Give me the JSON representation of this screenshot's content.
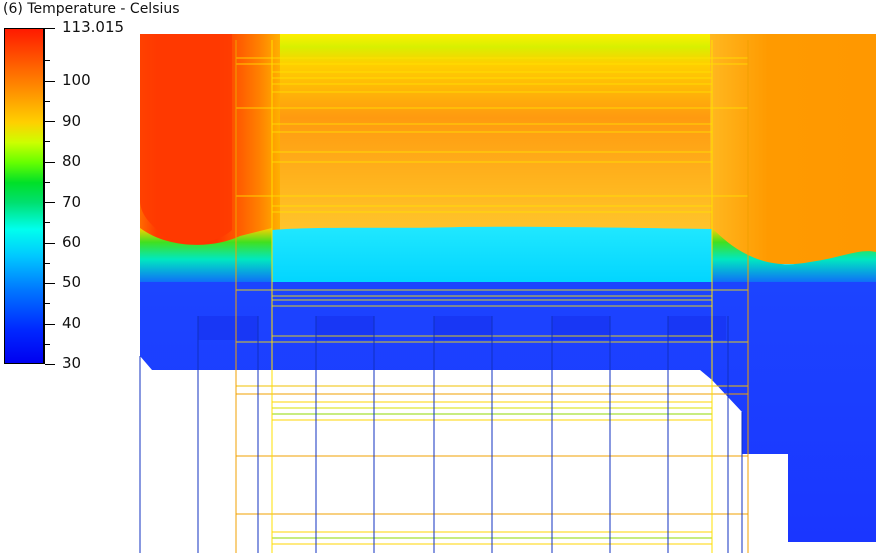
{
  "legend": {
    "title": "(6) Temperature - Celsius",
    "max_label": "113.015",
    "labels": [
      "100",
      "90",
      "80",
      "70",
      "60",
      "50",
      "40",
      "30"
    ],
    "values": [
      100,
      90,
      80,
      70,
      60,
      50,
      40,
      30
    ],
    "min": 30,
    "max": 113.015,
    "colormap": [
      "#0000f0",
      "#0050ff",
      "#00c8ff",
      "#00ffee",
      "#00e070",
      "#66ff00",
      "#ffd000",
      "#ff9a00",
      "#ff1a00"
    ]
  },
  "chart_data": {
    "type": "heatmap",
    "title": "(6) Temperature - Celsius",
    "variable": "Temperature",
    "unit": "Celsius",
    "range": [
      30,
      113.015
    ],
    "colorbar_ticks": [
      30,
      40,
      50,
      60,
      70,
      80,
      90,
      100,
      113.015
    ]
  },
  "colors": {
    "hot_red": "#ff3300",
    "hot_orange": "#ff9a10",
    "warm_yellow": "#ffd020",
    "green_band": "#20e020",
    "cyan_core": "#10e8ff",
    "blue_bottom": "#1a3cff",
    "mesh_yellow": "#ffe000",
    "mesh_orange": "#f0a000",
    "mesh_blue": "#1030c0"
  }
}
